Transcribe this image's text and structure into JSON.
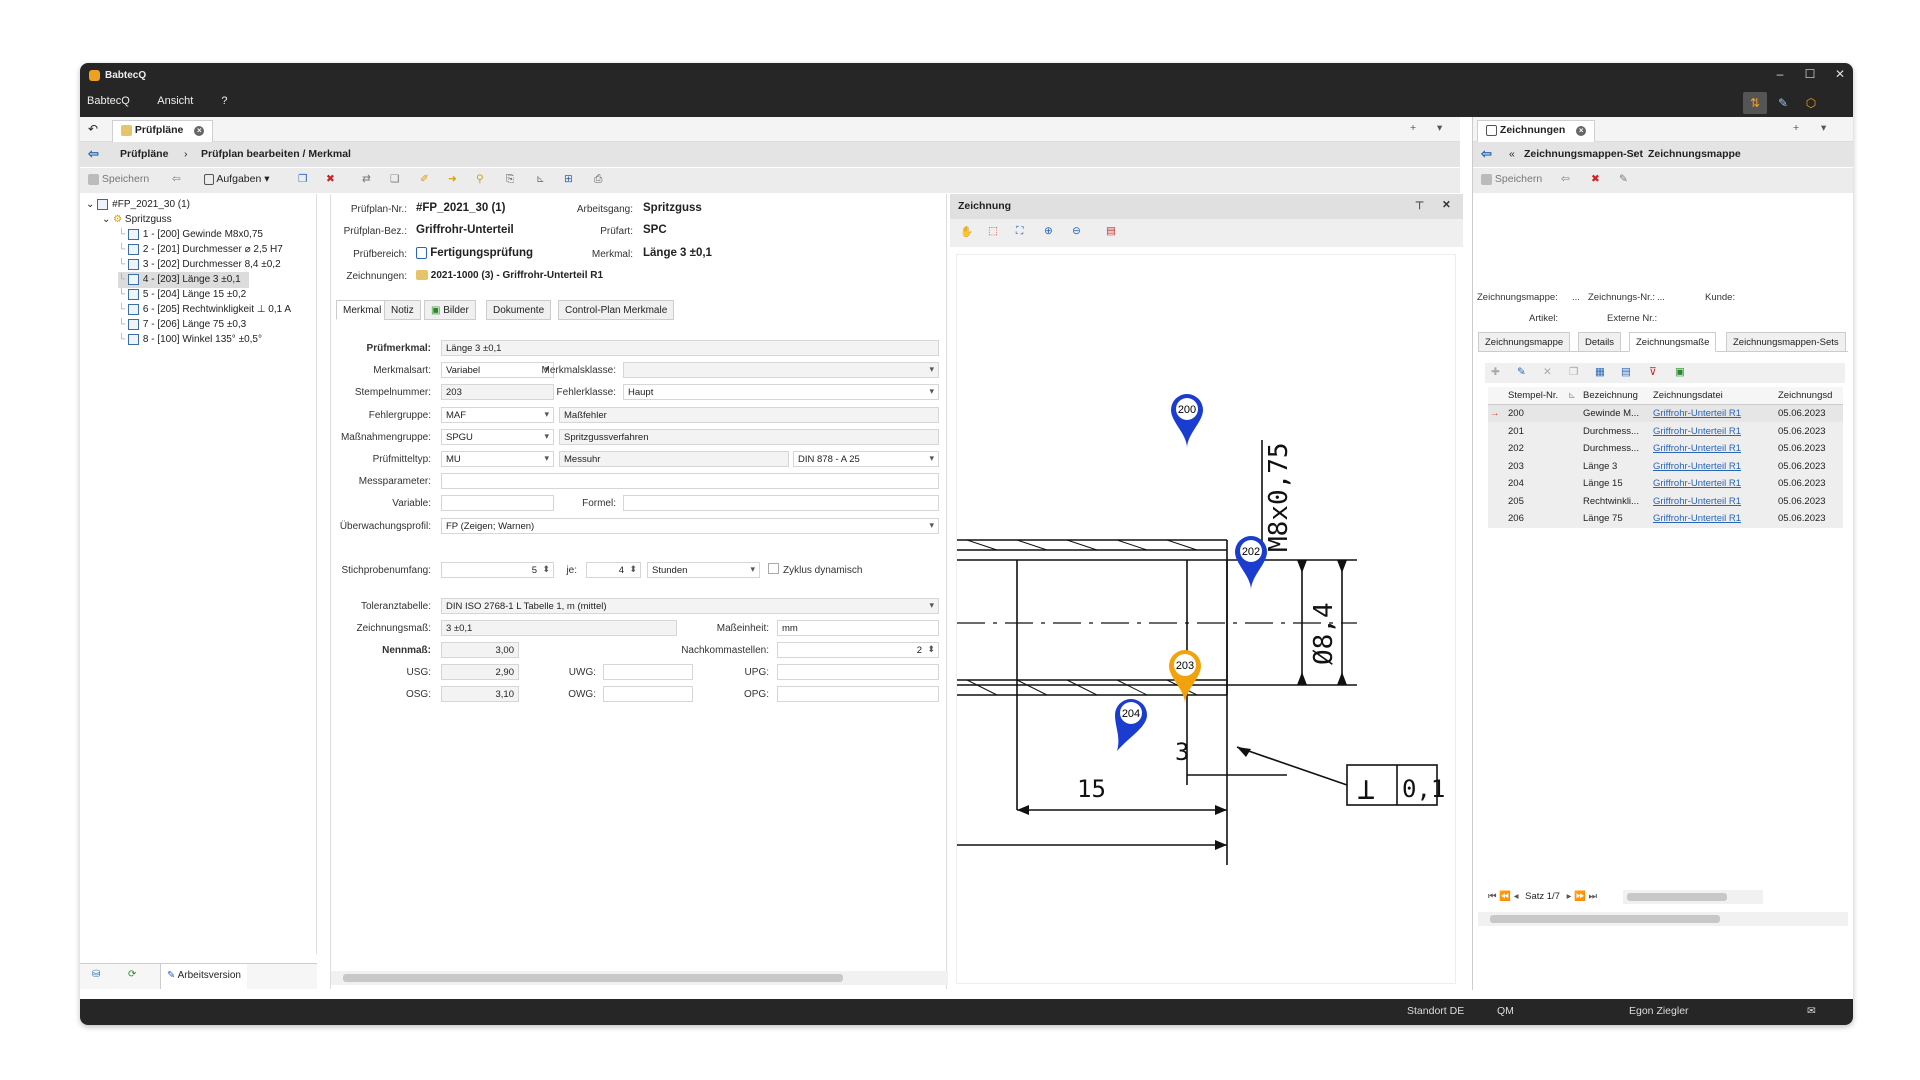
{
  "window": {
    "title": "BabtecQ",
    "controls": [
      "–",
      "☐",
      "✕"
    ]
  },
  "menu": [
    "BabtecQ",
    "Ansicht",
    "?"
  ],
  "left_tab": {
    "label": "Prüfpläne"
  },
  "right_tab": {
    "label": "Zeichnungen"
  },
  "breadcrumb": {
    "root": "Prüfpläne",
    "current": "Prüfplan bearbeiten / Merkmal"
  },
  "toolbar": {
    "save": "Speichern",
    "tasks": "Aufgaben"
  },
  "tree": {
    "root": "#FP_2021_30 (1)",
    "group": "Spritzguss",
    "items": [
      "1 - [200] Gewinde M8x0,75",
      "2 - [201] Durchmesser ⌀ 2,5 H7",
      "3 - [202] Durchmesser 8,4 ±0,2",
      "4 - [203] Länge 3 ±0,1",
      "5 - [204] Länge 15 ±0,2",
      "6 - [205] Rechtwinkligkeit ⊥ 0,1 A",
      "7 - [206] Länge 75 ±0,3",
      "8 - [100] Winkel 135° ±0,5°"
    ],
    "selected_index": 3,
    "bottom_button": "Arbeitsversion"
  },
  "header": {
    "pruefplan_nr_label": "Prüfplan-Nr.:",
    "pruefplan_nr": "#FP_2021_30 (1)",
    "arbeitsgang_label": "Arbeitsgang:",
    "arbeitsgang": "Spritzguss",
    "pruefplan_bez_label": "Prüfplan-Bez.:",
    "pruefplan_bez": "Griffrohr-Unterteil",
    "pruefart_label": "Prüfart:",
    "pruefart": "SPC",
    "pruefbereich_label": "Prüfbereich:",
    "pruefbereich": "Fertigungsprüfung",
    "merkmal_label": "Merkmal:",
    "merkmal": "Länge 3 ±0,1",
    "zeichnungen_label": "Zeichnungen:",
    "zeichnungen": "2021-1000 (3) - Griffrohr-Unterteil R1"
  },
  "form_tabs": [
    "Merkmal",
    "Notiz",
    "Bilder",
    "Dokumente",
    "Control-Plan Merkmale"
  ],
  "form": {
    "pruefmerkmal_label": "Prüfmerkmal:",
    "pruefmerkmal": "Länge 3 ±0,1",
    "merkmalsart_label": "Merkmalsart:",
    "merkmalsart": "Variabel",
    "merkmalsklasse_label": "Merkmalsklasse:",
    "merkmalsklasse": "",
    "stempelnummer_label": "Stempelnummer:",
    "stempelnummer": "203",
    "fehlerklasse_label": "Fehlerklasse:",
    "fehlerklasse": "Haupt",
    "fehlergruppe_label": "Fehlergruppe:",
    "fehlergruppe": "MAF",
    "fehlergruppe_text": "Maßfehler",
    "massnahmengruppe_label": "Maßnahmengruppe:",
    "massnahmengruppe": "SPGU",
    "massnahmengruppe_text": "Spritzgussverfahren",
    "pruefmitteltyp_label": "Prüfmitteltyp:",
    "pruefmitteltyp": "MU",
    "pruefmitteltyp_text": "Messuhr",
    "pruefmittel_norm": "DIN 878 - A 25",
    "messparameter_label": "Messparameter:",
    "variable_label": "Variable:",
    "formel_label": "Formel:",
    "ueberwachung_label": "Überwachungsprofil:",
    "ueberwachung": "FP (Zeigen; Warnen)",
    "stichprobe_label": "Stichprobenumfang:",
    "stichprobe": "5",
    "je_label": "je:",
    "je": "4",
    "einheit_zeit": "Stunden",
    "zyklus_label": "Zyklus dynamisch",
    "toleranz_label": "Toleranztabelle:",
    "toleranz": "DIN ISO 2768-1 L Tabelle 1, m (mittel)",
    "zeichnungsmass_label": "Zeichnungsmaß:",
    "zeichnungsmass": "3 ±0,1",
    "masseinheit_label": "Maßeinheit:",
    "masseinheit": "mm",
    "nennmass_label": "Nennmaß:",
    "nennmass": "3,00",
    "nachkomma_label": "Nachkommastellen:",
    "nachkomma": "2",
    "usg_label": "USG:",
    "usg": "2,90",
    "uwg_label": "UWG:",
    "upg_label": "UPG:",
    "osg_label": "OSG:",
    "osg": "3,10",
    "owg_label": "OWG:",
    "opg_label": "OPG:"
  },
  "drawing": {
    "title": "Zeichnung",
    "pins": [
      {
        "label": "200",
        "color": "#1a3ccf"
      },
      {
        "label": "202",
        "color": "#1a3ccf"
      },
      {
        "label": "203",
        "color": "#f2a20c"
      },
      {
        "label": "204",
        "color": "#1a3ccf"
      }
    ],
    "dims": {
      "thread": "M8x0,75",
      "dia": "Ø8,4",
      "len3": "3",
      "len15": "15",
      "tol": "0,1",
      "perp": "⊥"
    }
  },
  "right_panel": {
    "breadcrumb_root": "Zeichnungsmappen-Set",
    "breadcrumb_current": "Zeichnungsmappe",
    "save": "Speichern",
    "fields": {
      "mappe": "Zeichnungsmappe:",
      "mappe_val": "...",
      "znr": "Zeichnungs-Nr.:",
      "znr_val": "...",
      "kunde": "Kunde:",
      "artikel": "Artikel:",
      "extern": "Externe Nr.:"
    },
    "tabs": [
      "Zeichnungsmappe",
      "Details",
      "Zeichnungsmaße",
      "Zeichnungsmappen-Sets"
    ],
    "columns": [
      "Stempel-Nr.",
      "Bezeichnung",
      "Zeichnungsdatei",
      "Zeichnungsd"
    ],
    "rows": [
      {
        "nr": "200",
        "bez": "Gewinde M...",
        "file": "Griffrohr-Unterteil R1",
        "date": "05.06.2023"
      },
      {
        "nr": "201",
        "bez": "Durchmess...",
        "file": "Griffrohr-Unterteil R1",
        "date": "05.06.2023"
      },
      {
        "nr": "202",
        "bez": "Durchmess...",
        "file": "Griffrohr-Unterteil R1",
        "date": "05.06.2023"
      },
      {
        "nr": "203",
        "bez": "Länge 3",
        "file": "Griffrohr-Unterteil R1",
        "date": "05.06.2023"
      },
      {
        "nr": "204",
        "bez": "Länge 15",
        "file": "Griffrohr-Unterteil R1",
        "date": "05.06.2023"
      },
      {
        "nr": "205",
        "bez": "Rechtwinkli...",
        "file": "Griffrohr-Unterteil R1",
        "date": "05.06.2023"
      },
      {
        "nr": "206",
        "bez": "Länge 75",
        "file": "Griffrohr-Unterteil R1",
        "date": "05.06.2023"
      }
    ],
    "pager": "Satz 1/7"
  },
  "status": {
    "standort": "Standort DE",
    "modul": "QM",
    "user": "Egon Ziegler"
  },
  "colors": {
    "pin_blue": "#1a3ccf",
    "pin_orange": "#f2a20c",
    "titlebar": "#262626"
  }
}
